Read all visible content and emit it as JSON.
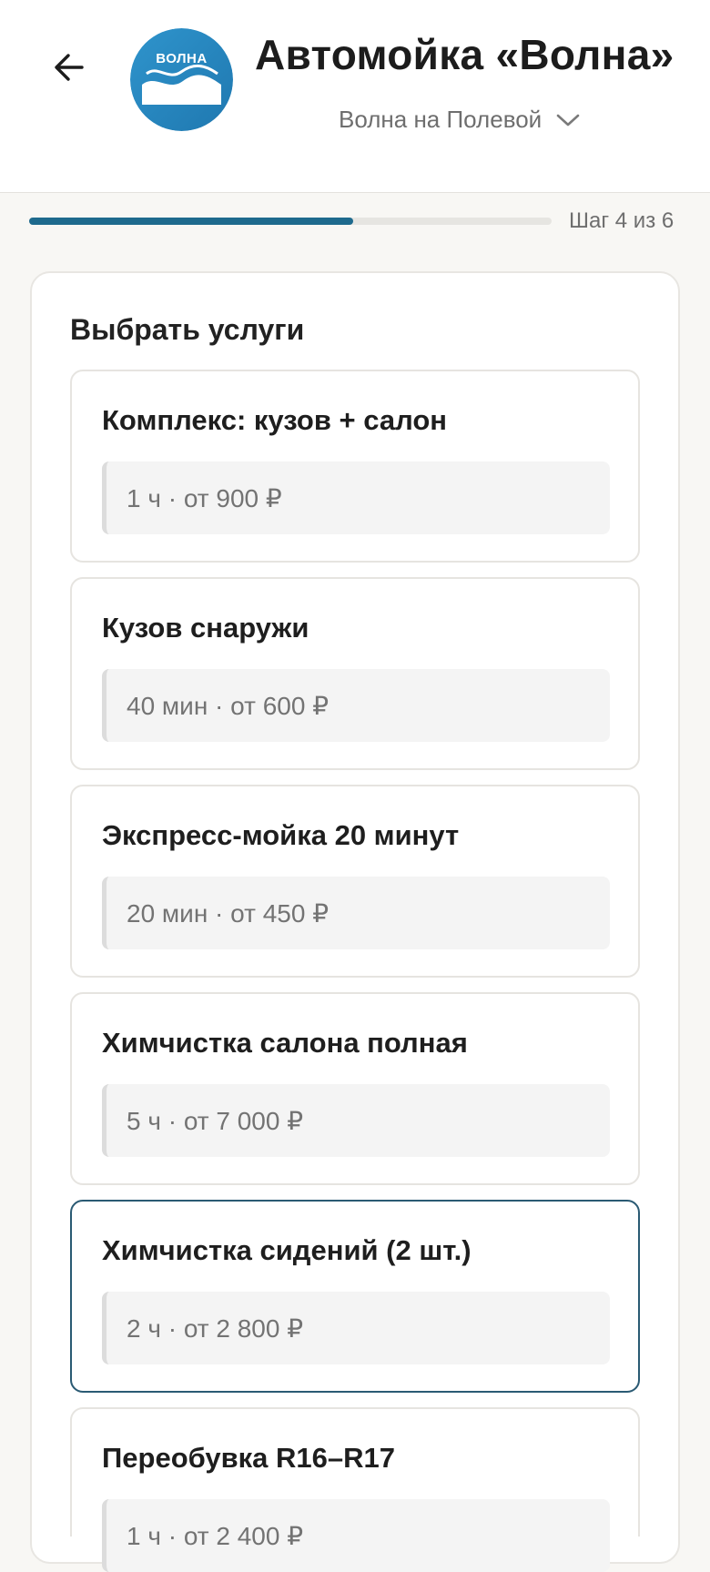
{
  "header": {
    "title": "Автомойка «Волна»",
    "branch": "Волна на Полевой",
    "logo_text": "ВОЛНА",
    "back_icon": "arrow-left-icon",
    "chevron_icon": "chevron-down-icon"
  },
  "progress": {
    "label": "Шаг 4 из 6",
    "current": 4,
    "total": 6,
    "fill_fraction": 0.62
  },
  "section": {
    "title": "Выбрать услуги"
  },
  "services": [
    {
      "name": "Комплекс: кузов + салон",
      "meta": "1 ч · от 900 ₽",
      "selected": false
    },
    {
      "name": "Кузов снаружи",
      "meta": "40 мин · от 600 ₽",
      "selected": false
    },
    {
      "name": "Экспресс-мойка 20 минут",
      "meta": "20 мин · от 450 ₽",
      "selected": false
    },
    {
      "name": "Химчистка салона полная",
      "meta": "5 ч · от 7 000 ₽",
      "selected": false
    },
    {
      "name": "Химчистка сидений (2 шт.)",
      "meta": "2 ч · от 2 800 ₽",
      "selected": true
    },
    {
      "name": "Переобувка R16–R17",
      "meta": "1 ч · от 2 400 ₽",
      "selected": false
    }
  ],
  "colors": {
    "accent": "#1e6a8d",
    "selected_border": "#2a5a73",
    "logo_blue": "#2a8ac2",
    "page_bg": "#f8f7f4"
  }
}
